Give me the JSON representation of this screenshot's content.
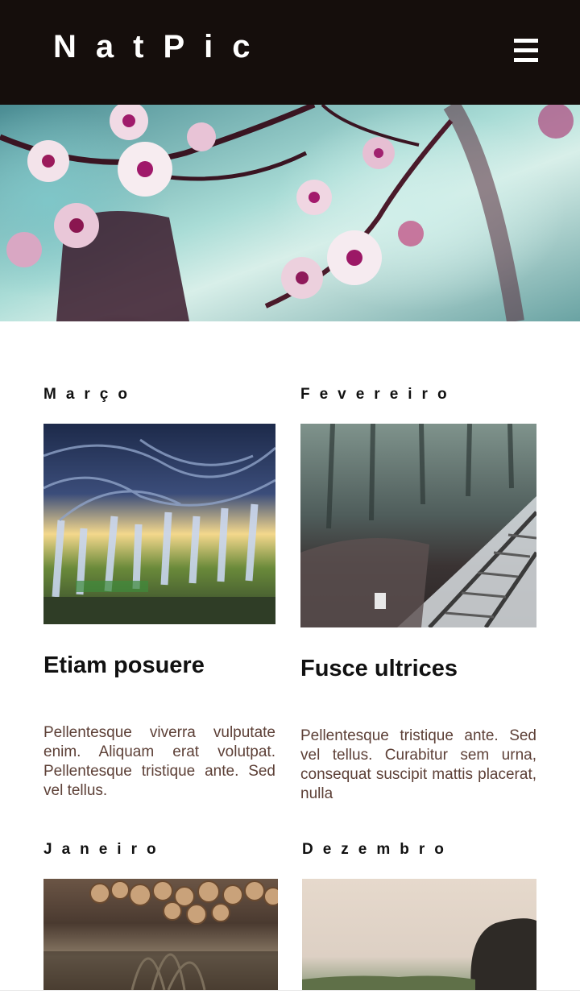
{
  "header": {
    "logo": "NatPic",
    "menu_icon": "hamburger-menu-icon"
  },
  "hero": {
    "image": "cherry-blossom-branch"
  },
  "posts": [
    {
      "month": "Março",
      "image": "orchard-trees-photo",
      "title": "Etiam posuere",
      "text": "Pellentesque viverra vulputate enim. Aliquam erat volutpat. Pellentesque tristique ante. Sed vel tellus."
    },
    {
      "month": "Fevereiro",
      "image": "misty-railway-photo",
      "title": "Fusce ultrices",
      "text": "Pellentesque tristique ante. Sed vel tellus. Curabitur sem urna, consequat suscipit mattis placerat, nulla"
    },
    {
      "month": "Janeiro",
      "image": "woodpile-grass-photo"
    },
    {
      "month": "Dezembro",
      "image": "rock-landscape-photo"
    }
  ],
  "colors": {
    "header_bg": "#150e0c",
    "body_text": "#5d4037",
    "heading": "#111111"
  }
}
